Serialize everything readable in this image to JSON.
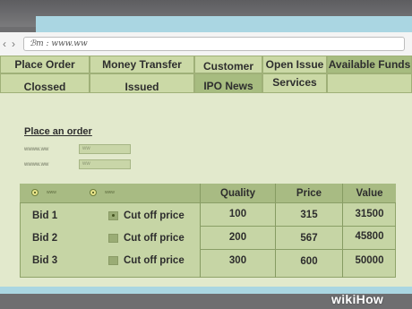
{
  "browser": {
    "url": "ℬm : www.ww"
  },
  "nav": {
    "row1": [
      "Place Order",
      "Money Transfer",
      "Customer",
      "Open Issue",
      "Available Funds"
    ],
    "row2": [
      "Clossed",
      "Issued",
      "IPO News",
      "Services"
    ]
  },
  "order": {
    "title": "Place an order",
    "fields": [
      {
        "label": "wwww.ww",
        "value": "ww"
      },
      {
        "label": "wwww.ww",
        "value": "ww"
      }
    ]
  },
  "table": {
    "radios": [
      {
        "label": "www",
        "selected": true
      },
      {
        "label": "www",
        "selected": true
      }
    ],
    "headers": [
      "Quality",
      "Price",
      "Value"
    ],
    "rows": [
      {
        "name": "Bid 1",
        "option": "Cut off price",
        "checked": true,
        "quality": "100",
        "price": "315",
        "value": "31500"
      },
      {
        "name": "Bid 2",
        "option": "Cut off price",
        "checked": false,
        "quality": "200",
        "price": "567",
        "value": "45800"
      },
      {
        "name": "Bid 3",
        "option": "Cut off price",
        "checked": false,
        "quality": "300",
        "price": "600",
        "value": "50000"
      }
    ]
  },
  "watermark": {
    "wiki": "wiki",
    "how": "How"
  }
}
